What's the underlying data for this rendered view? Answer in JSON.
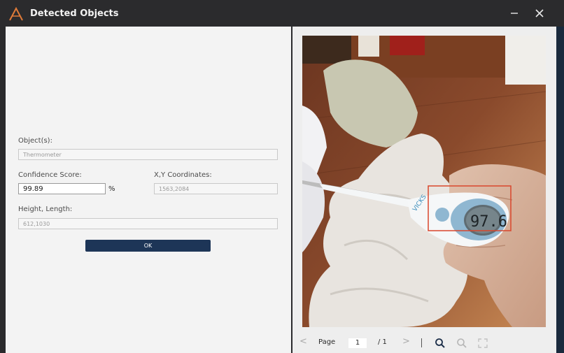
{
  "window": {
    "title": "Detected Objects",
    "minimize_label": "—",
    "close_label": "✕"
  },
  "form": {
    "objects_label": "Object(s):",
    "objects_value": "Thermometer",
    "confidence_label": "Confidence Score:",
    "confidence_value": "99.89",
    "confidence_unit": "%",
    "coords_label": "X,Y Coordinates:",
    "coords_value": "1563,2084",
    "size_label": "Height, Length:",
    "size_value": "612,1030",
    "ok_label": "OK"
  },
  "viewer": {
    "thermometer_reading": "97.6",
    "detection_box_color": "#d9462c"
  },
  "pager": {
    "prev_label": "<",
    "page_label": "Page",
    "current_page": "1",
    "total_label": "/ 1",
    "next_label": ">"
  },
  "colors": {
    "ok_button": "#1d3557",
    "titlebar": "#2b2b2d"
  }
}
